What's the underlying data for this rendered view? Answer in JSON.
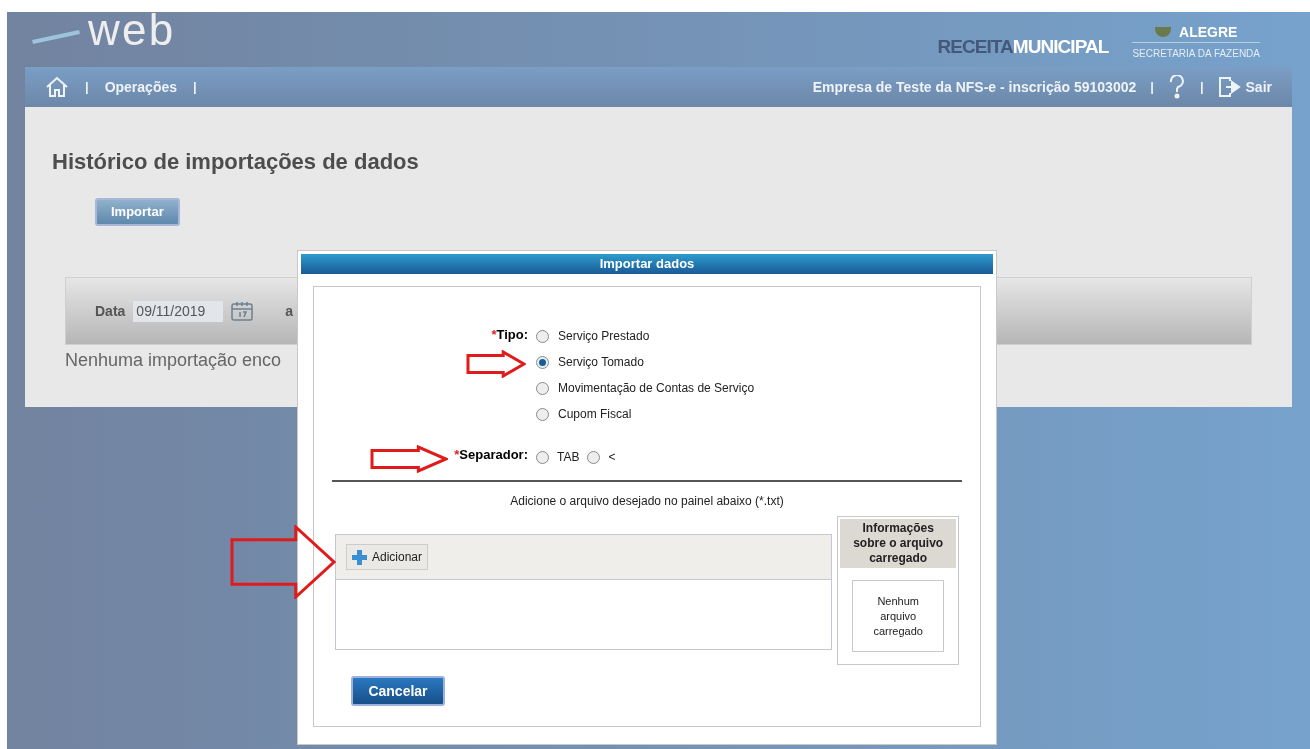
{
  "header": {
    "logo": "web",
    "city": "ALEGRE",
    "brand_left": "RECEITA",
    "brand_right": "MUNICIPAL",
    "department": "SECRETARIA DA FAZENDA"
  },
  "nav": {
    "left": [
      {
        "kind": "home"
      },
      {
        "kind": "separator",
        "text": "|"
      },
      {
        "kind": "link",
        "text": "Operações"
      },
      {
        "kind": "separator",
        "text": "|"
      }
    ],
    "right": [
      {
        "kind": "text",
        "text": "Empresa de Teste da NFS-e - inscrição 59103002"
      },
      {
        "kind": "separator",
        "text": "|"
      },
      {
        "kind": "help"
      },
      {
        "kind": "separator",
        "text": "|"
      },
      {
        "kind": "logout",
        "text": "Sair"
      }
    ]
  },
  "page": {
    "title": "Histórico de importações de dados",
    "import_button": "Importar",
    "filter": {
      "date_label": "Data",
      "date_value": "09/11/2019",
      "to_label": "a"
    },
    "empty_message": "Nenhuma importação enco"
  },
  "dialog": {
    "title": "Importar dados",
    "type": {
      "required_mark": "*",
      "label": "Tipo:",
      "options": [
        {
          "label": "Serviço Prestado",
          "selected": false
        },
        {
          "label": "Serviço Tomado",
          "selected": true
        },
        {
          "label": "Movimentação de Contas de Serviço",
          "selected": false
        },
        {
          "label": "Cupom Fiscal",
          "selected": false
        }
      ]
    },
    "separator": {
      "required_mark": "*",
      "label": "Separador:",
      "options": [
        {
          "label": "TAB",
          "selected": false
        },
        {
          "label": "<",
          "selected": false
        }
      ]
    },
    "instruction": "Adicione o arquivo desejado no painel abaixo (*.txt)",
    "add_button": "Adicionar",
    "info": {
      "title": "Informações sobre o arquivo carregado",
      "message": "Nenhum arquivo carregado"
    },
    "cancel_button": "Cancelar"
  }
}
